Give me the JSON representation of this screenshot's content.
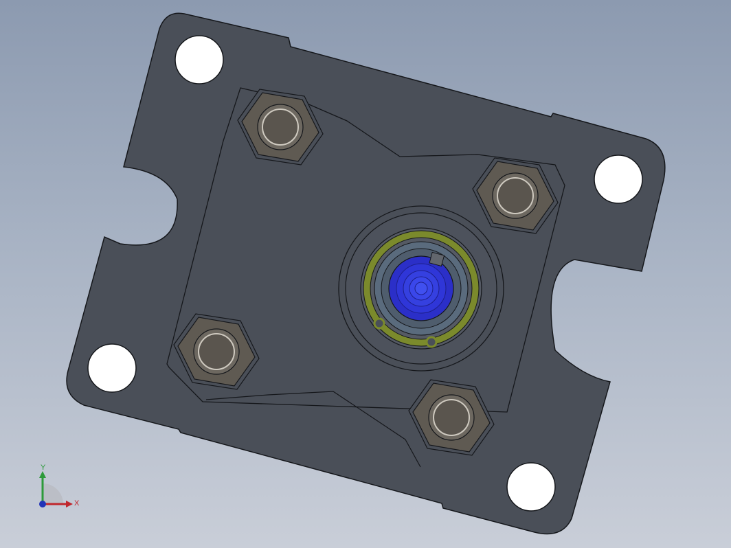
{
  "viewport": {
    "background_top": "#8c9ab0",
    "background_bottom": "#c9ced8"
  },
  "model": {
    "plate_color": "#4a4f58",
    "edge_color": "#15171b",
    "nut_color": "#5f5a52",
    "bolt_face_color": "#6d6860",
    "ring_color": "#7b8a2c",
    "core_color": "#2b2fc8"
  },
  "triad": {
    "x_label": "X",
    "y_label": "Y",
    "x_color": "#c0262c",
    "y_color": "#2d9a3a",
    "z_color": "#2234b8"
  }
}
